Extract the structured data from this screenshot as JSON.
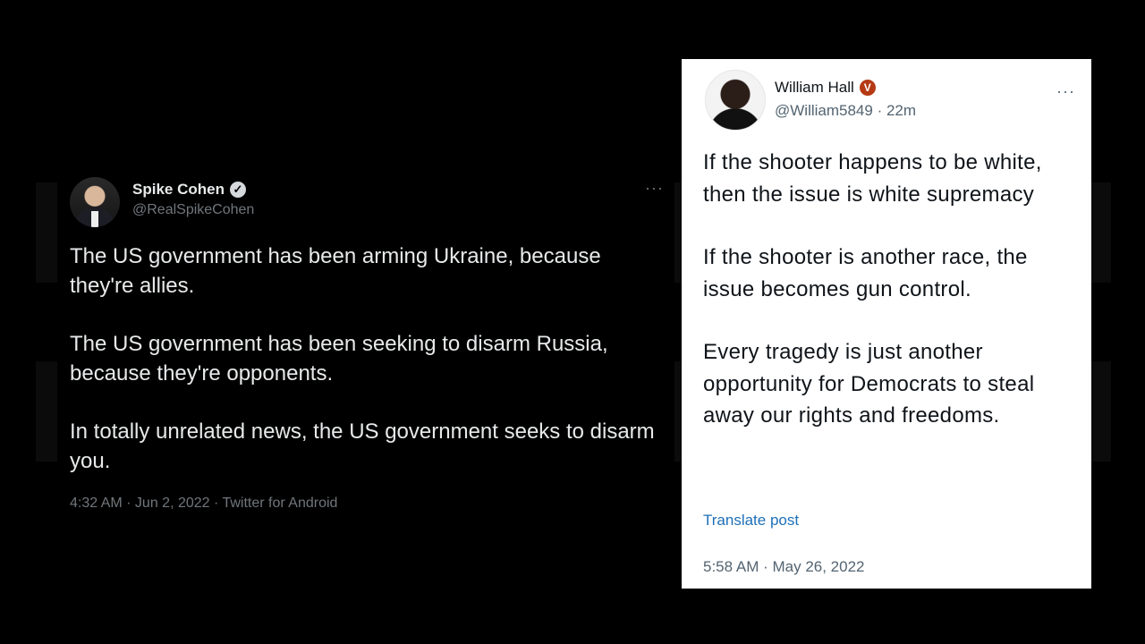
{
  "left_tweet": {
    "author_name": "Spike Cohen",
    "handle": "@RealSpikeCohen",
    "more_label": "···",
    "verified_badge": "✓",
    "paragraphs": [
      "The US government has been arming Ukraine, because they're allies.",
      "The US government has been seeking to disarm Russia, because they're opponents.",
      "In totally unrelated news, the US government seeks to disarm you."
    ],
    "timestamp": "4:32 AM · Jun 2, 2022 · Twitter for Android"
  },
  "right_tweet": {
    "author_name": "William Hall",
    "handle": "@William5849",
    "age": "· 22m",
    "more_label": "···",
    "verified_badge": "V",
    "paragraphs": [
      "If the shooter happens to be white, then the issue is white supremacy",
      "If the shooter is another race, the issue becomes gun control.",
      "Every tragedy is just another opportunity for Democrats to steal away our rights and freedoms."
    ],
    "translate_label": "Translate post",
    "timestamp": "5:58 AM · May 26, 2022"
  },
  "colors": {
    "background": "#000000",
    "dark_text": "#e7e9ea",
    "dark_secondary": "#71767b",
    "light_text": "#0f1419",
    "light_secondary": "#536471",
    "link": "#1d6fb8",
    "badge_red": "#b53a14"
  }
}
